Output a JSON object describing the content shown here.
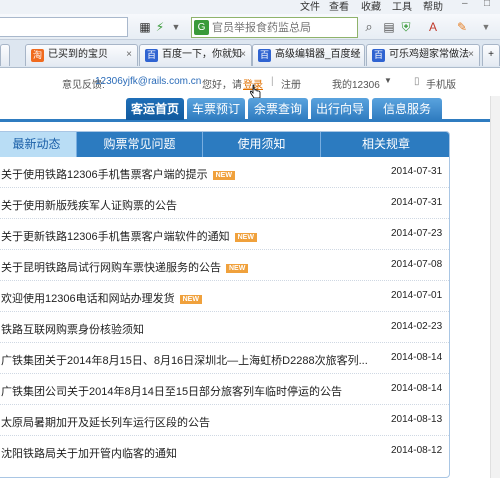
{
  "browser": {
    "menu": [
      "文件",
      "查看",
      "收藏",
      "工具",
      "帮助"
    ],
    "search_placeholder": "官员举报食药监总局",
    "tabs": [
      {
        "label": "已买到的宝贝",
        "favicon": "taobao-icon"
      },
      {
        "label": "百度一下，你就知",
        "favicon": "baidu-icon"
      },
      {
        "label": "高级编辑器_百度经",
        "favicon": "baidu-icon"
      },
      {
        "label": "可乐鸡翅家常做法",
        "favicon": "baidu-icon"
      }
    ]
  },
  "header": {
    "feedback_label": "意见反馈:",
    "feedback_email": "12306yjfk@rails.com.cn",
    "greeting": "您好，请",
    "login": "登录",
    "separator": "|",
    "register": "注册",
    "my_account": "我的12306",
    "mobile": "手机版"
  },
  "nav": {
    "items": [
      "客运首页",
      "车票预订",
      "余票查询",
      "出行向导",
      "信息服务"
    ],
    "active_index": 0
  },
  "notice": {
    "tabs": [
      "最新动态",
      "购票常见问题",
      "使用须知",
      "相关规章"
    ],
    "active_tab": 0,
    "new_badge": "NEW",
    "rows": [
      {
        "title": "关于使用铁路12306手机售票客户端的提示",
        "is_new": true,
        "date": "2014-07-31"
      },
      {
        "title": "关于使用新版残疾军人证购票的公告",
        "is_new": false,
        "date": "2014-07-31"
      },
      {
        "title": "关于更新铁路12306手机售票客户端软件的通知",
        "is_new": true,
        "date": "2014-07-23"
      },
      {
        "title": "关于昆明铁路局试行网购车票快递服务的公告",
        "is_new": true,
        "date": "2014-07-08"
      },
      {
        "title": "欢迎使用12306电话和网站办理发货",
        "is_new": true,
        "date": "2014-07-01"
      },
      {
        "title": "铁路互联网购票身份核验须知",
        "is_new": false,
        "date": "2014-02-23"
      },
      {
        "title": "广铁集团关于2014年8月15日、8月16日深圳北—上海虹桥D2288次旅客列...",
        "is_new": false,
        "date": "2014-08-14"
      },
      {
        "title": "广铁集团公司关于2014年8月14日至15日部分旅客列车临时停运的公告",
        "is_new": false,
        "date": "2014-08-14"
      },
      {
        "title": "太原局暑期加开及延长列车运行区段的公告",
        "is_new": false,
        "date": "2014-08-13"
      },
      {
        "title": "沈阳铁路局关于加开管内临客的通知",
        "is_new": false,
        "date": "2014-08-12"
      }
    ]
  },
  "colors": {
    "nav_blue": "#2f7cc0",
    "active_tab": "#b9ddf5",
    "new_badge": "#f0a13c",
    "login_link": "#e07000"
  }
}
